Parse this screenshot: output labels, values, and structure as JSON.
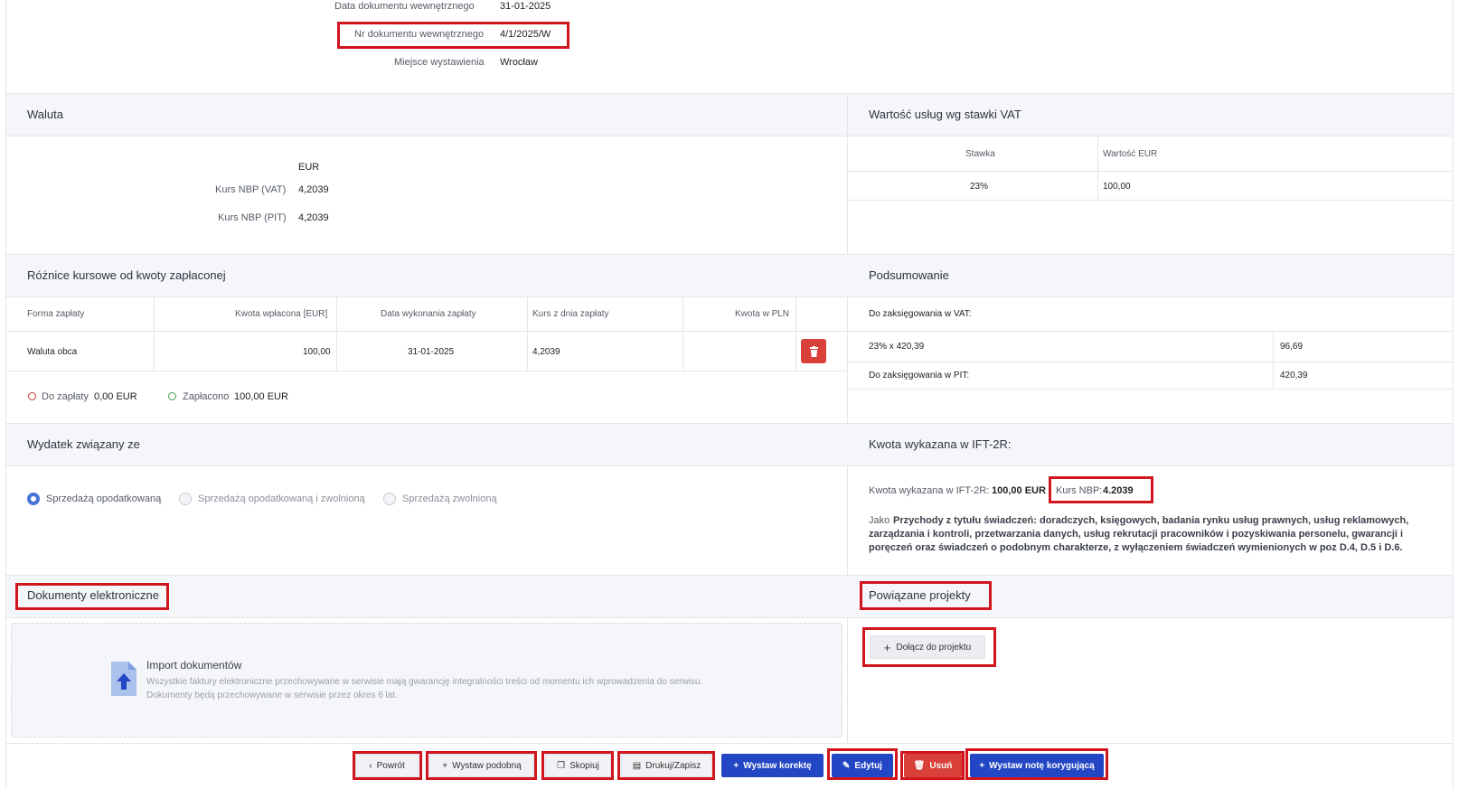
{
  "doc_info": {
    "date_label": "Data dokumentu wewnętrznego",
    "date_value": "31-01-2025",
    "number_label": "Nr dokumentu wewnętrznego",
    "number_value": "4/1/2025/W",
    "place_label": "Miejsce wystawienia",
    "place_value": "Wrocław"
  },
  "waluta": {
    "title": "Waluta",
    "currency": "EUR",
    "kurs_vat_label": "Kurs NBP (VAT)",
    "kurs_vat_value": "4,2039",
    "kurs_pit_label": "Kurs NBP (PIT)",
    "kurs_pit_value": "4,2039"
  },
  "vat_values": {
    "title": "Wartość usług wg stawki VAT",
    "col_stawka": "Stawka",
    "col_wartosc": "Wartość EUR",
    "row_stawka": "23%",
    "row_wartosc": "100,00"
  },
  "roznice": {
    "title": "Różnice kursowe od kwoty zapłaconej",
    "columns": [
      "Forma zapłaty",
      "Kwota wpłacona [EUR]",
      "Data wykonania zapłaty",
      "Kurs z dnia zapłaty",
      "Kwota w PLN"
    ],
    "row": [
      "Waluta obca",
      "100,00",
      "31-01-2025",
      "4,2039",
      ""
    ],
    "do_zaplaty_label": "Do zapłaty",
    "do_zaplaty_value": "0,00 EUR",
    "zaplacono_label": "Zapłacono",
    "zaplacono_value": "100,00 EUR"
  },
  "podsumowanie": {
    "title": "Podsumowanie",
    "vat_label": "Do zaksięgowania w VAT:",
    "vat_row_left": "23% x 420,39",
    "vat_row_right": "96,69",
    "pit_label": "Do zaksięgowania w PIT:",
    "pit_value": "420,39"
  },
  "wydatek": {
    "title": "Wydatek związany ze",
    "options": [
      "Sprzedażą opodatkowaną",
      "Sprzedażą opodatkowaną i zwolnioną",
      "Sprzedażą zwolnioną"
    ],
    "selected_index": 0
  },
  "ift": {
    "title": "Kwota wykazana w IFT-2R:",
    "kwota_label": "Kwota wykazana w IFT-2R:",
    "kwota_value": "100,00 EUR",
    "kurs_label": "Kurs NBP:",
    "kurs_value": "4.2039",
    "jako_prefix": "Jako",
    "desc_line1": "Przychody z tytułu świadczeń: doradczych, księgowych, badania rynku usług prawnych, usług reklamowych,",
    "desc_line2": "zarządzania i kontroli, przetwarzania danych, usług rekrutacji pracowników i pozyskiwania personelu, gwarancji i",
    "desc_line3": "poręczeń oraz świadczeń o podobnym charakterze, z wyłączeniem świadczeń wymienionych w poz D.4, D.5 i D.6."
  },
  "dokumenty": {
    "title": "Dokumenty elektroniczne",
    "import_title": "Import dokumentów",
    "import_line1": "Wszystkie faktury elektroniczne przechowywane w serwisie mają gwarancję integralności treści od momentu ich wprowadzenia do serwisu.",
    "import_line2": "Dokumenty będą przechowywane w serwisie przez okres 6 lat."
  },
  "projekty": {
    "title": "Powiązane projekty",
    "join_button": "Dołącz do projektu"
  },
  "actions": {
    "back": "Powrót",
    "issue_similar": "Wystaw podobną",
    "copy": "Skopiuj",
    "print": "Drukuj/Zapisz",
    "correction": "Wystaw korektę",
    "edit": "Edytuj",
    "delete": "Usuń",
    "note": "Wystaw notę korygującą"
  },
  "colors": {
    "highlight": "#d0151e",
    "primary": "#2346c4",
    "danger": "#d9403a",
    "radio_checked": "#4a74d8"
  }
}
